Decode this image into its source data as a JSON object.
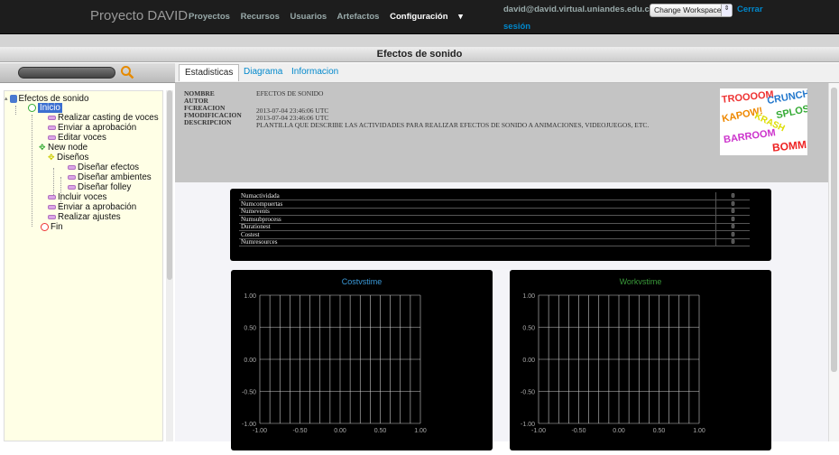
{
  "header": {
    "brand": "Proyecto DAVID",
    "nav": [
      "Proyectos",
      "Recursos",
      "Usuarios",
      "Artefactos",
      "Configuración"
    ],
    "active_nav_suffix": " ▾",
    "user_email": "david@david.virtual.uniandes.edu.co.",
    "workspace_select": "Change Workspace",
    "logout_1": "Cerrar",
    "logout_2": "sesión"
  },
  "page_title": "Efectos de sonido",
  "sidebar": {
    "tree": {
      "root": "Efectos de sonido",
      "inicio": "Inicio",
      "t1": "Realizar casting de voces",
      "t2": "Enviar a aprobación",
      "t3": "Editar voces",
      "new_node": "New node",
      "disenos": "Diseños",
      "d1": "Diseñar efectos",
      "d2": "Diseñar ambientes",
      "d3": "Diseñar folley",
      "t4": "Incluir voces",
      "t5": "Enviar a aprobación",
      "t6": "Realizar ajustes",
      "fin": "Fin"
    }
  },
  "tabs": [
    "Estadisticas",
    "Diagrama",
    "Informacion"
  ],
  "meta": {
    "nombre_k": "NOMBRE",
    "nombre_v": "EFECTOS DE SONIDO",
    "autor_k": "AUTOR",
    "autor_v": "",
    "fcreacion_k": "FCREACION",
    "fcreacion_v": "2013-07-04 23:46:06 UTC",
    "fmod_k": "FMODIFICACION",
    "fmod_v": "2013-07-04 23:46:06 UTC",
    "desc_k": "DESCRIPCION",
    "desc_v": "PLANTILLA QUE DESCRIBE LAS ACTIVIDADES PARA REALIZAR EFECTOS DE SONIDO A ANIMACIONES, VIDEOJUEGOS, ETC."
  },
  "comic_words": [
    "TROOOOM",
    "CRUNCH!",
    "KAPOW!",
    "KRASH",
    "SPLOSH!",
    "BARROOM",
    "BOMM"
  ],
  "stats": [
    {
      "k": "Numactividada",
      "v": "0"
    },
    {
      "k": "Numcompuertas",
      "v": "0"
    },
    {
      "k": "Numevents",
      "v": "0"
    },
    {
      "k": "Numsubprocess",
      "v": "0"
    },
    {
      "k": "Durationest",
      "v": "0"
    },
    {
      "k": "Costest",
      "v": "0"
    },
    {
      "k": "Numresources",
      "v": "0"
    }
  ],
  "chart_data": [
    {
      "type": "line",
      "title": "Costvstime",
      "title_color": "#3b9ad9",
      "xlim": [
        -1,
        1
      ],
      "ylim": [
        -1,
        1
      ],
      "x_ticks": [
        "-1.00",
        "-0.50",
        "0.00",
        "0.50",
        "1.00"
      ],
      "y_ticks": [
        "1.00",
        "0.50",
        "0.00",
        "-0.50",
        "-1.00"
      ],
      "grid": true,
      "series": []
    },
    {
      "type": "line",
      "title": "Workvstime",
      "title_color": "#3a9a3a",
      "xlim": [
        -1,
        1
      ],
      "ylim": [
        -1,
        1
      ],
      "x_ticks": [
        "-1.00",
        "-0.50",
        "0.00",
        "0.50",
        "1.00"
      ],
      "y_ticks": [
        "1.00",
        "0.50",
        "0.00",
        "-0.50",
        "-1.00"
      ],
      "grid": true,
      "series": []
    }
  ]
}
